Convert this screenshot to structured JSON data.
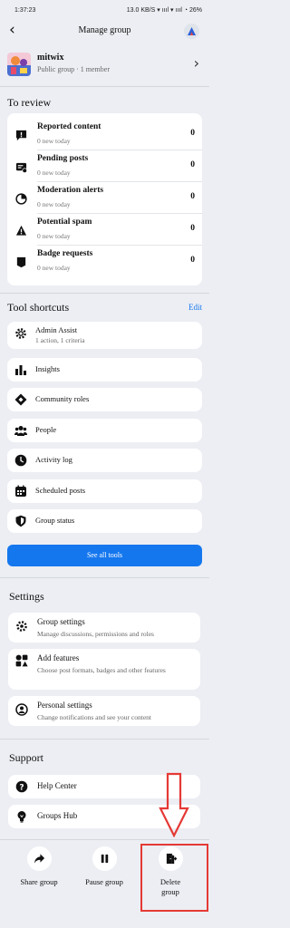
{
  "status_bar": {
    "time": "1:37:23",
    "right": "13.0 KB/S  ▾ ıııl  ▾ ıııl  ◔ 26%"
  },
  "header": {
    "title": "Manage group"
  },
  "group": {
    "name": "mitwix",
    "meta": "Public group · 1 member"
  },
  "review": {
    "heading": "To review",
    "items": [
      {
        "title": "Reported content",
        "sub": "0 new today",
        "count": "0",
        "icon": "reported-icon"
      },
      {
        "title": "Pending posts",
        "sub": "0 new today",
        "count": "0",
        "icon": "pending-icon"
      },
      {
        "title": "Moderation alerts",
        "sub": "0 new today",
        "count": "0",
        "icon": "alert-icon"
      },
      {
        "title": "Potential spam",
        "sub": "0 new today",
        "count": "0",
        "icon": "warning-icon"
      },
      {
        "title": "Badge requests",
        "sub": "0 new today",
        "count": "0",
        "icon": "badge-icon"
      }
    ]
  },
  "tools": {
    "heading": "Tool shortcuts",
    "edit": "Edit",
    "items": [
      {
        "label": "Admin Assist",
        "sub": "1 action, 1 criteria",
        "icon": "gear-icon"
      },
      {
        "label": "Insights",
        "icon": "bar-chart-icon"
      },
      {
        "label": "Community roles",
        "icon": "diamond-icon"
      },
      {
        "label": "People",
        "icon": "people-icon"
      },
      {
        "label": "Activity log",
        "icon": "clock-icon"
      },
      {
        "label": "Scheduled posts",
        "icon": "calendar-icon"
      },
      {
        "label": "Group status",
        "icon": "shield-icon"
      }
    ],
    "see_all": "See all tools"
  },
  "settings": {
    "heading": "Settings",
    "items": [
      {
        "title": "Group settings",
        "sub": "Manage discussions, permissions and roles",
        "icon": "gear-icon"
      },
      {
        "title": "Add features",
        "sub": "Choose post formats, badges and other features",
        "icon": "grid-icon"
      },
      {
        "title": "Personal settings",
        "sub": "Change notifications and see your content",
        "icon": "person-gear-icon"
      }
    ]
  },
  "support": {
    "heading": "Support",
    "items": [
      {
        "label": "Help Center",
        "icon": "help-icon"
      },
      {
        "label": "Groups Hub",
        "icon": "bulb-icon"
      }
    ]
  },
  "actions": [
    {
      "label": "Share group",
      "icon": "share-icon"
    },
    {
      "label": "Pause group",
      "icon": "pause-icon"
    },
    {
      "label": "Delete group",
      "icon": "delete-group-icon"
    }
  ],
  "colors": {
    "accent": "#1577ee",
    "highlight": "#e53935",
    "background": "#eceef3"
  }
}
